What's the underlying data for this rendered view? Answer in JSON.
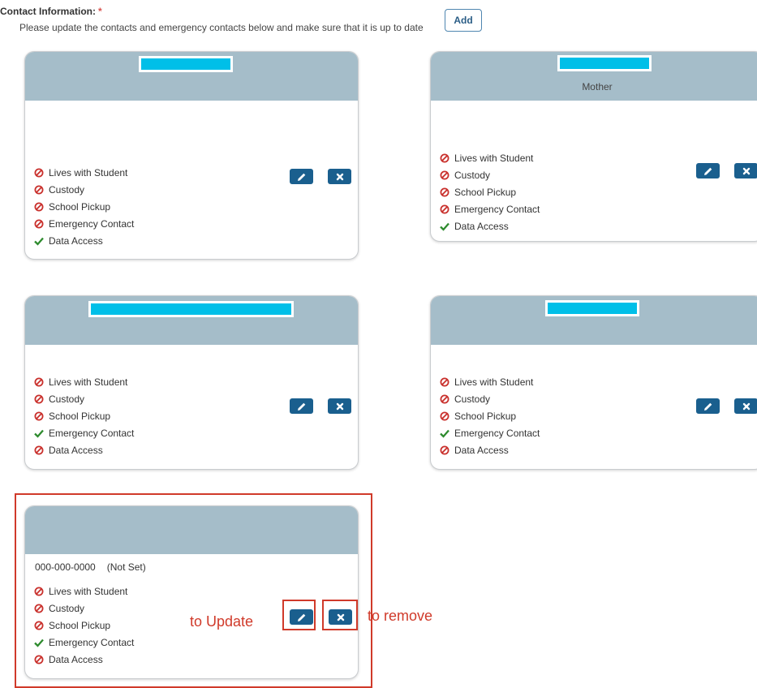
{
  "header": {
    "title": "Contact Information:",
    "required_mark": "*",
    "subtitle": "Please update the contacts and emergency contacts below and make sure that it is up to date",
    "add_label": "Add"
  },
  "flag_labels": {
    "lives": "Lives with Student",
    "custody": "Custody",
    "pickup": "School Pickup",
    "emergency": "Emergency Contact",
    "data": "Data Access"
  },
  "contacts": [
    {
      "relation": "",
      "flags": {
        "lives": false,
        "custody": false,
        "pickup": false,
        "emergency": false,
        "data": true
      }
    },
    {
      "relation": "Mother",
      "flags": {
        "lives": false,
        "custody": false,
        "pickup": false,
        "emergency": false,
        "data": true
      }
    },
    {
      "relation": "",
      "flags": {
        "lives": false,
        "custody": false,
        "pickup": false,
        "emergency": true,
        "data": false
      }
    },
    {
      "relation": "",
      "flags": {
        "lives": false,
        "custody": false,
        "pickup": false,
        "emergency": true,
        "data": false
      }
    },
    {
      "relation": "",
      "phone": "000-000-0000",
      "phone_status": "(Not Set)",
      "flags": {
        "lives": false,
        "custody": false,
        "pickup": false,
        "emergency": true,
        "data": false
      }
    }
  ],
  "annotations": {
    "update_label": "to Update",
    "remove_label": "to remove",
    "color": "#d03a2a"
  },
  "icons": {
    "no": "ban-icon",
    "yes": "check-icon",
    "edit": "pencil-icon",
    "remove": "close-icon"
  },
  "colors": {
    "card_header": "#a5bdc9",
    "action_button": "#1a5f8e",
    "redaction": "#00bfe8",
    "no_icon": "#c9302c",
    "yes_icon": "#2e8b2e"
  }
}
